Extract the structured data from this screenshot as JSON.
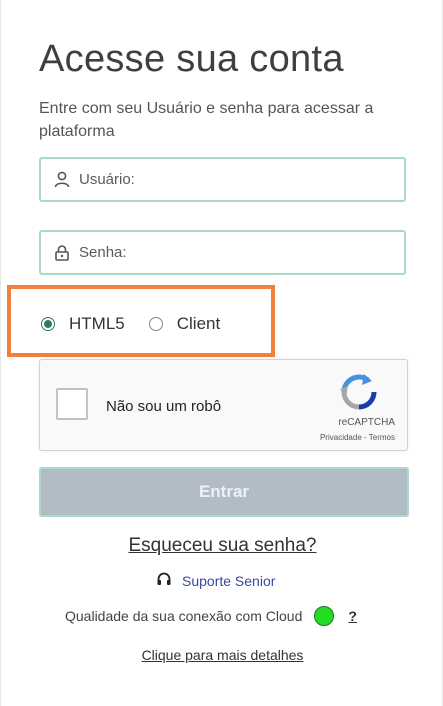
{
  "title": "Acesse sua conta",
  "subtitle": "Entre com seu Usuário e senha para acessar a plataforma",
  "username": {
    "placeholder": "Usuário:",
    "value": "",
    "icon": "user-icon"
  },
  "password": {
    "placeholder": "Senha:",
    "value": "",
    "icon": "lock-icon"
  },
  "mode": {
    "options": [
      {
        "label": "HTML5",
        "checked": true
      },
      {
        "label": "Client",
        "checked": false
      }
    ]
  },
  "recaptcha": {
    "label": "Não sou um robô",
    "brand": "reCAPTCHA",
    "privacy": "Privacidade",
    "separator": "-",
    "terms": "Termos"
  },
  "submit_label": "Entrar",
  "forgot_label": "Esqueceu sua senha?",
  "support_label": "Suporte Senior",
  "quality": {
    "label": "Qualidade da sua conexão com Cloud",
    "help": "?",
    "status_color": "#22dd22"
  },
  "details_label": "Clique para mais detalhes",
  "colors": {
    "accent": "#a8d9cc",
    "highlight": "#f0803c",
    "button": "#b2bcc6",
    "link": "#3a48a0"
  }
}
